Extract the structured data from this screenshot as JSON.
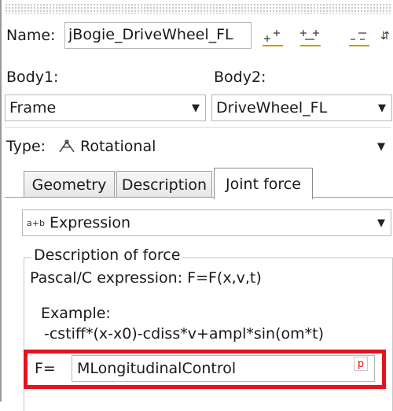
{
  "header": {
    "name_label": "Name:",
    "name_value": "jBogie_DriveWheel_FL",
    "toolbar_icons": [
      "insert-icon",
      "split-icon",
      "dash-icon",
      "overflow-icon"
    ],
    "overflow_glyph": "⇵"
  },
  "bodies": {
    "body1_label": "Body1:",
    "body1_value": "Frame",
    "body2_label": "Body2:",
    "body2_value": "DriveWheel_FL"
  },
  "type": {
    "label": "Type:",
    "icon": "rotational-joint-icon",
    "value": "Rotational"
  },
  "tabs": [
    {
      "label": "Geometry",
      "active": false
    },
    {
      "label": "Description",
      "active": false
    },
    {
      "label": "Joint force",
      "active": true
    }
  ],
  "force": {
    "mode_icon_text": "a+b",
    "mode_value": "Expression",
    "group_title": "Description of force",
    "pascal_text": "Pascal/C expression: F=F(x,v,t)",
    "example_title": "Example:",
    "example_text": "-cstiff*(x-x0)-cdiss*v+ampl*sin(om*t)",
    "f_label": "F=",
    "f_value": "MLongitudinalControl",
    "param_button": "p"
  },
  "colors": {
    "highlight": "#e5141f",
    "icon_accent": "#c8a000"
  }
}
